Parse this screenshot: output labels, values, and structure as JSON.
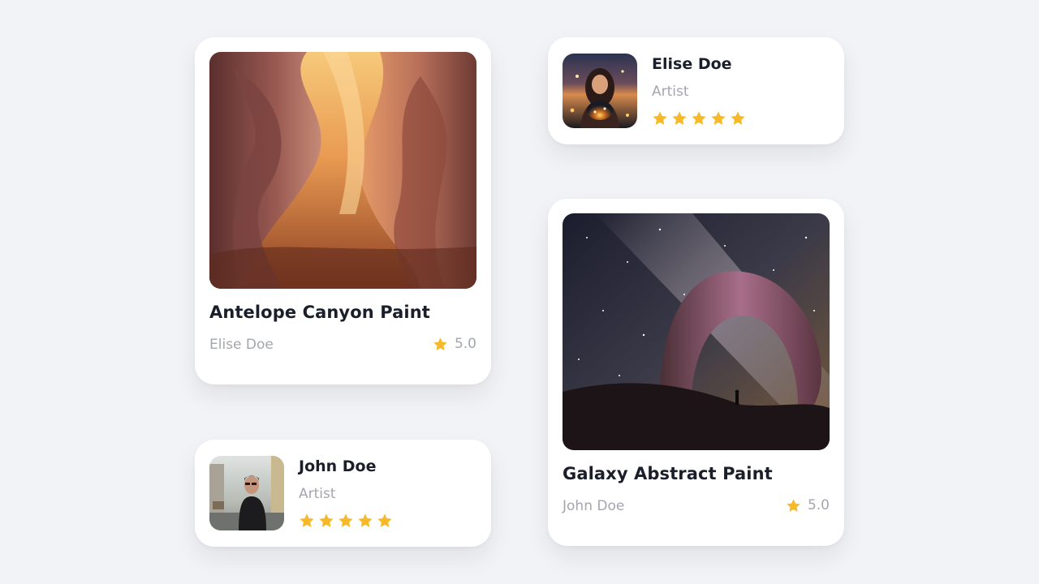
{
  "colors": {
    "background": "#f2f3f6",
    "card": "#ffffff",
    "title_text": "#1b1f2a",
    "muted_text": "#a3a6ad",
    "star": "#f6b928"
  },
  "cards": {
    "canyon": {
      "image": "antelope-canyon-photo",
      "title": "Antelope Canyon Paint",
      "artist": "Elise Doe",
      "rating": "5.0",
      "rating_icon": "star-icon"
    },
    "galaxy": {
      "image": "galaxy-arch-photo",
      "title": "Galaxy Abstract Paint",
      "artist": "John Doe",
      "rating": "5.0",
      "rating_icon": "star-icon"
    }
  },
  "profiles": {
    "elise": {
      "avatar": "woman-with-lights-photo",
      "name": "Elise Doe",
      "role": "Artist",
      "stars": 5
    },
    "john": {
      "avatar": "man-in-black-photo",
      "name": "John Doe",
      "role": "Artist",
      "stars": 5
    }
  }
}
